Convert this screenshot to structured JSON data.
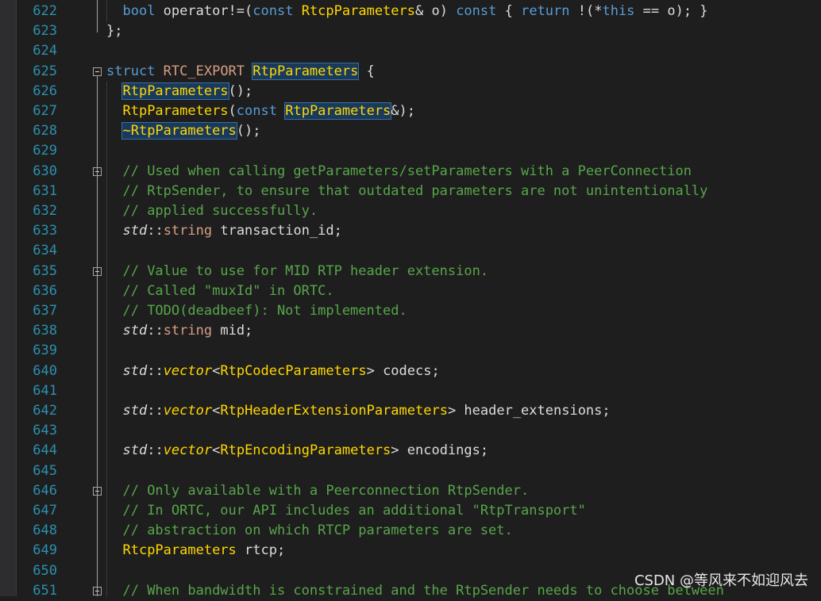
{
  "lines": [
    {
      "num": "622",
      "tokens": [
        [
          "n",
          "  "
        ],
        [
          "k",
          "bool"
        ],
        [
          "n",
          " operator!=("
        ],
        [
          "k",
          "const"
        ],
        [
          "n",
          " "
        ],
        [
          "s",
          "RtcpParameters"
        ],
        [
          "n",
          "& o) "
        ],
        [
          "k",
          "const"
        ],
        [
          "n",
          " { "
        ],
        [
          "k",
          "return"
        ],
        [
          "n",
          " !(*"
        ],
        [
          "k",
          "this"
        ],
        [
          "n",
          " == o); }"
        ]
      ]
    },
    {
      "num": "623",
      "tokens": [
        [
          "n",
          "};"
        ]
      ]
    },
    {
      "num": "624",
      "tokens": []
    },
    {
      "num": "625",
      "tokens": [
        [
          "k",
          "struct"
        ],
        [
          "n",
          " "
        ],
        [
          "m",
          "RTC_EXPORT"
        ],
        [
          "n",
          " "
        ],
        [
          "boxs",
          "RtpParameters"
        ],
        [
          "n",
          " {"
        ]
      ]
    },
    {
      "num": "626",
      "tokens": [
        [
          "n",
          "  "
        ],
        [
          "boxs",
          "RtpParameters"
        ],
        [
          "n",
          "();"
        ]
      ]
    },
    {
      "num": "627",
      "tokens": [
        [
          "n",
          "  "
        ],
        [
          "s",
          "RtpParameters"
        ],
        [
          "n",
          "("
        ],
        [
          "k",
          "const"
        ],
        [
          "n",
          " "
        ],
        [
          "boxs",
          "RtpParameters"
        ],
        [
          "n",
          "&);"
        ]
      ]
    },
    {
      "num": "628",
      "tokens": [
        [
          "n",
          "  "
        ],
        [
          "boxs",
          "~RtpParameters"
        ],
        [
          "n",
          "();"
        ]
      ]
    },
    {
      "num": "629",
      "tokens": []
    },
    {
      "num": "630",
      "tokens": [
        [
          "n",
          "  "
        ],
        [
          "g",
          "// Used when calling getParameters/setParameters with a PeerConnection"
        ]
      ]
    },
    {
      "num": "631",
      "tokens": [
        [
          "n",
          "  "
        ],
        [
          "g",
          "// RtpSender, to ensure that outdated parameters are not unintentionally"
        ]
      ]
    },
    {
      "num": "632",
      "tokens": [
        [
          "n",
          "  "
        ],
        [
          "g",
          "// applied successfully."
        ]
      ]
    },
    {
      "num": "633",
      "tokens": [
        [
          "n",
          "  "
        ],
        [
          "ni",
          "std"
        ],
        [
          "n",
          "::"
        ],
        [
          "mm",
          "string"
        ],
        [
          "n",
          " transaction_id;"
        ]
      ]
    },
    {
      "num": "634",
      "tokens": []
    },
    {
      "num": "635",
      "tokens": [
        [
          "n",
          "  "
        ],
        [
          "g",
          "// Value to use for MID RTP header extension."
        ]
      ]
    },
    {
      "num": "636",
      "tokens": [
        [
          "n",
          "  "
        ],
        [
          "g",
          "// Called \"muxId\" in ORTC."
        ]
      ]
    },
    {
      "num": "637",
      "tokens": [
        [
          "n",
          "  "
        ],
        [
          "g",
          "// TODO(deadbeef): Not implemented."
        ]
      ]
    },
    {
      "num": "638",
      "tokens": [
        [
          "n",
          "  "
        ],
        [
          "ni",
          "std"
        ],
        [
          "n",
          "::"
        ],
        [
          "mm",
          "string"
        ],
        [
          "n",
          " mid;"
        ]
      ]
    },
    {
      "num": "639",
      "tokens": []
    },
    {
      "num": "640",
      "tokens": [
        [
          "n",
          "  "
        ],
        [
          "ni",
          "std"
        ],
        [
          "n",
          "::"
        ],
        [
          "si",
          "vector"
        ],
        [
          "n",
          "<"
        ],
        [
          "s",
          "RtpCodecParameters"
        ],
        [
          "n",
          "> codecs;"
        ]
      ]
    },
    {
      "num": "641",
      "tokens": []
    },
    {
      "num": "642",
      "tokens": [
        [
          "n",
          "  "
        ],
        [
          "ni",
          "std"
        ],
        [
          "n",
          "::"
        ],
        [
          "si",
          "vector"
        ],
        [
          "n",
          "<"
        ],
        [
          "s",
          "RtpHeaderExtensionParameters"
        ],
        [
          "n",
          "> header_extensions;"
        ]
      ]
    },
    {
      "num": "643",
      "tokens": []
    },
    {
      "num": "644",
      "tokens": [
        [
          "n",
          "  "
        ],
        [
          "ni",
          "std"
        ],
        [
          "n",
          "::"
        ],
        [
          "si",
          "vector"
        ],
        [
          "n",
          "<"
        ],
        [
          "s",
          "RtpEncodingParameters"
        ],
        [
          "n",
          "> encodings;"
        ]
      ]
    },
    {
      "num": "645",
      "tokens": []
    },
    {
      "num": "646",
      "tokens": [
        [
          "n",
          "  "
        ],
        [
          "g",
          "// Only available with a Peerconnection RtpSender."
        ]
      ]
    },
    {
      "num": "647",
      "tokens": [
        [
          "n",
          "  "
        ],
        [
          "g",
          "// In ORTC, our API includes an additional \"RtpTransport\""
        ]
      ]
    },
    {
      "num": "648",
      "tokens": [
        [
          "n",
          "  "
        ],
        [
          "g",
          "// abstraction on which RTCP parameters are set."
        ]
      ]
    },
    {
      "num": "649",
      "tokens": [
        [
          "n",
          "  "
        ],
        [
          "s",
          "RtcpParameters"
        ],
        [
          "n",
          " rtcp;"
        ]
      ]
    },
    {
      "num": "650",
      "tokens": []
    },
    {
      "num": "651",
      "tokens": [
        [
          "n",
          "  "
        ],
        [
          "g",
          "// When bandwidth is constrained and the RtpSender needs to choose between"
        ]
      ]
    }
  ],
  "watermark": "CSDN @等风来不如迎风去",
  "colors": {
    "background": "#1e1e1e",
    "line_number": "#2b91af",
    "keyword": "#569cd6",
    "user_type": "#ffd700",
    "macro": "#d69d85",
    "comment": "#57a64a",
    "text": "#dcdcdc"
  },
  "icons": [
    "fold-collapse-icon"
  ]
}
